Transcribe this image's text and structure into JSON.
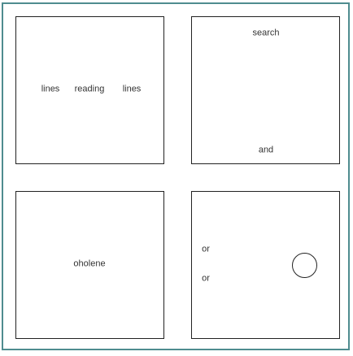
{
  "colors": {
    "frame_border": "#4f8c8f",
    "panel_border": "#222222",
    "text": "#333333",
    "background": "#ffffff"
  },
  "panels": [
    {
      "labels": [
        "lines",
        "reading",
        "lines"
      ]
    },
    {
      "labels": [
        "search",
        "and"
      ]
    },
    {
      "labels": [
        "oholene"
      ]
    },
    {
      "labels": [
        "or",
        "or"
      ],
      "shape": "circle"
    }
  ]
}
